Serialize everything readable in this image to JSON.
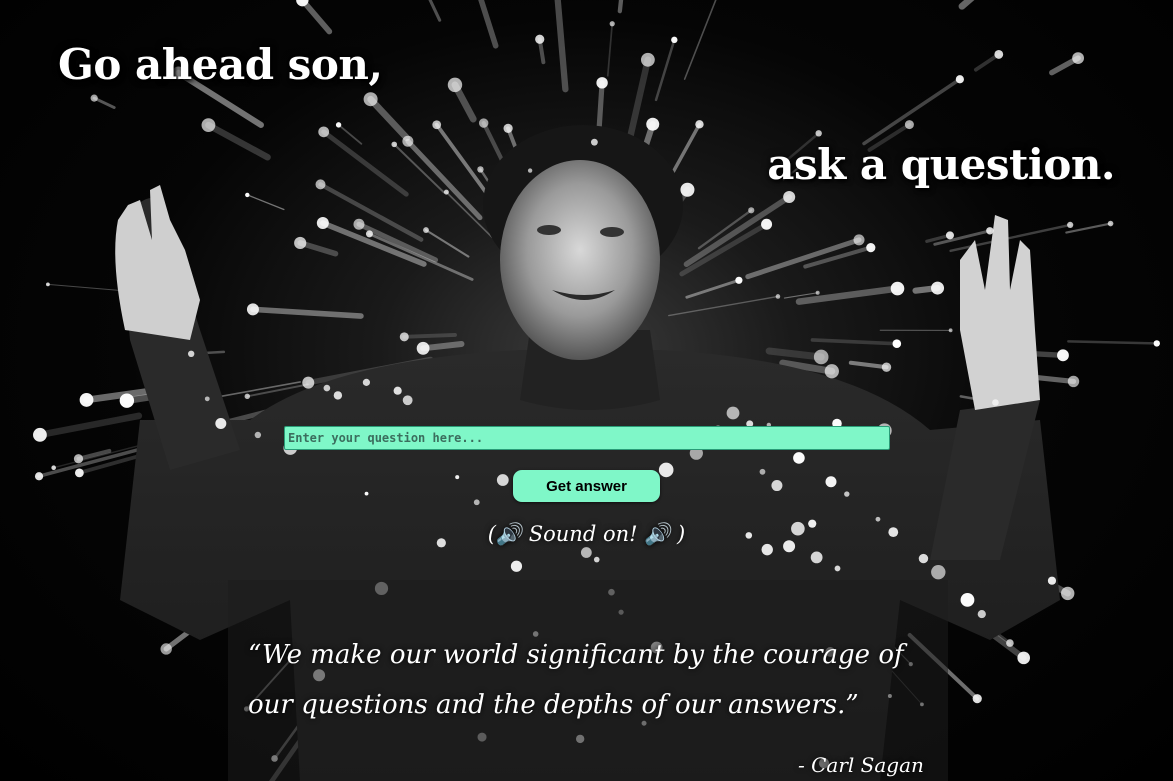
{
  "headline": {
    "line1": "Go ahead son,",
    "line2": "ask a question."
  },
  "form": {
    "input_placeholder": "Enter your question here...",
    "input_value": "",
    "button_label": "Get answer",
    "accent_color": "#7ff7c8"
  },
  "sound_note": "(🔊 Sound on! 🔊 )",
  "quote": {
    "text": "“We make our world significant by the courage of our questions and the depths of our answers.”",
    "author": "- Carl Sagan"
  },
  "background": {
    "subject": "carl-sagan-photo",
    "effect": "starburst-light-streaks"
  }
}
